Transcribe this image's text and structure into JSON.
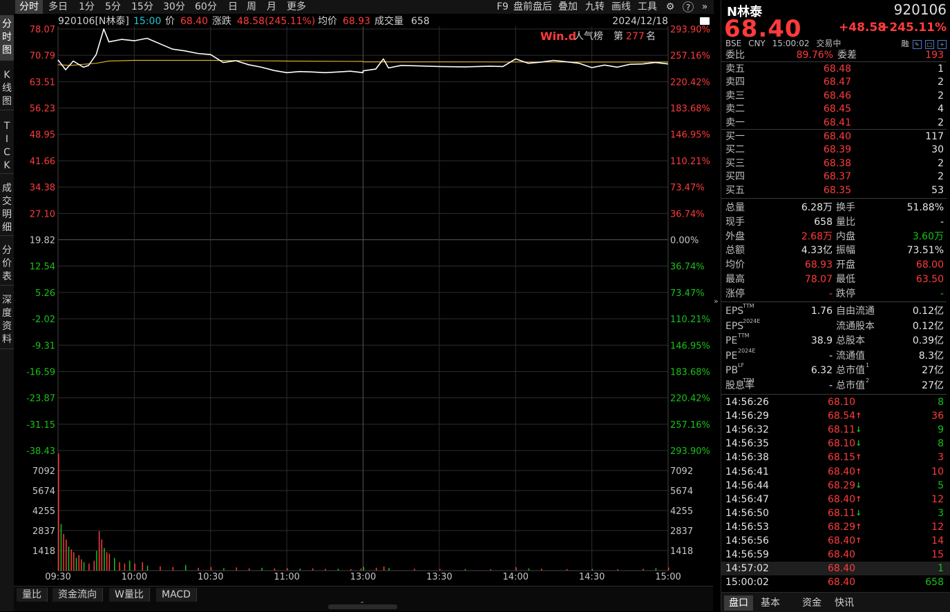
{
  "toolbar": {
    "periods": [
      "分时",
      "多日",
      "1分",
      "5分",
      "15分",
      "30分",
      "60分",
      "日",
      "周",
      "月",
      "更多"
    ],
    "active_period": "分时",
    "right_items": [
      "F9",
      "盘前盘后",
      "叠加",
      "九转",
      "画线",
      "工具"
    ],
    "settings_icon": "gear-icon",
    "help_icon": "help-icon",
    "expand_icon": "double-chevron-right-icon"
  },
  "sidebar": {
    "items": [
      "分时图",
      "K线图",
      "TICK",
      "成交明细",
      "分价表",
      "深度资料"
    ],
    "active": "分时图"
  },
  "chart_header": {
    "code_name": "920106[N林泰]",
    "time": "15:00",
    "price_label": "价",
    "price": "68.40",
    "change_label": "涨跌",
    "change": "48.58(245.11%)",
    "avg_label": "均价",
    "avg": "68.93",
    "volume_label": "成交量",
    "volume": "658",
    "date": "2024/12/18",
    "wind_brand": "Win.d",
    "popularity_label": "人气榜",
    "rank_prefix": "第",
    "rank": "277",
    "rank_suffix": "名"
  },
  "chart_data": {
    "type": "line",
    "title": "",
    "prev_close": 19.82,
    "price_ticks_upper": [
      "78.07",
      "70.79",
      "63.51",
      "56.23",
      "48.95",
      "41.66",
      "34.38",
      "27.10"
    ],
    "price_tick_center": "19.82",
    "price_ticks_lower": [
      "12.54",
      "5.26",
      "-2.02",
      "-9.31",
      "-16.59",
      "-23.87",
      "-31.15",
      "-38.43"
    ],
    "pct_ticks_upper": [
      "293.90%",
      "257.16%",
      "220.42%",
      "183.68%",
      "146.95%",
      "110.21%",
      "73.47%",
      "36.74%"
    ],
    "pct_tick_center": "0.00%",
    "pct_ticks_lower": [
      "36.74%",
      "73.47%",
      "110.21%",
      "146.95%",
      "183.68%",
      "220.42%",
      "257.16%",
      "293.90%"
    ],
    "volume_ticks": [
      "7092",
      "5674",
      "4255",
      "2837",
      "1418"
    ],
    "time_ticks": [
      "09:30",
      "10:00",
      "10:30",
      "11:00",
      "13:00",
      "13:30",
      "14:00",
      "14:30",
      "15:00"
    ],
    "ylim": [
      -38.43,
      78.07
    ],
    "volume_max": 8510,
    "series": [
      {
        "name": "价",
        "color": "#ffffff",
        "times": [
          "09:30",
          "09:33",
          "09:36",
          "09:40",
          "09:42",
          "09:45",
          "09:48",
          "09:50",
          "09:55",
          "10:00",
          "10:05",
          "10:10",
          "10:15",
          "10:20",
          "10:25",
          "10:30",
          "10:35",
          "10:40",
          "10:45",
          "10:50",
          "10:55",
          "11:00",
          "11:05",
          "11:10",
          "11:15",
          "11:20",
          "11:25",
          "11:30",
          "13:00",
          "13:05",
          "13:08",
          "13:10",
          "13:15",
          "13:20",
          "13:30",
          "13:40",
          "13:50",
          "13:55",
          "14:00",
          "14:05",
          "14:10",
          "14:15",
          "14:20",
          "14:25",
          "14:30",
          "14:35",
          "14:40",
          "14:45",
          "14:50",
          "14:55",
          "15:00"
        ],
        "values": [
          69.5,
          66.8,
          69.2,
          67.5,
          68.0,
          71.0,
          78.07,
          74.5,
          75.2,
          74.8,
          75.5,
          74.0,
          72.5,
          72.0,
          71.3,
          71.0,
          68.8,
          69.3,
          68.2,
          67.5,
          66.6,
          66.0,
          66.3,
          66.2,
          66.0,
          66.2,
          66.4,
          66.0,
          66.5,
          67.0,
          69.8,
          67.3,
          68.0,
          67.9,
          67.7,
          67.6,
          67.8,
          67.7,
          69.8,
          68.6,
          68.9,
          69.4,
          69.0,
          68.6,
          67.4,
          68.1,
          67.5,
          68.3,
          68.4,
          68.8,
          68.4
        ]
      },
      {
        "name": "均价",
        "color": "#d9b030",
        "times": [
          "09:30",
          "09:35",
          "09:40",
          "09:45",
          "09:50",
          "10:00",
          "10:30",
          "11:00",
          "11:30",
          "13:00",
          "13:30",
          "14:00",
          "14:30",
          "15:00"
        ],
        "values": [
          68.2,
          68.0,
          68.3,
          68.6,
          69.2,
          69.4,
          69.4,
          69.2,
          69.1,
          69.0,
          69.0,
          68.95,
          68.93,
          68.93
        ]
      }
    ],
    "volume_bars": [
      {
        "time": "09:30",
        "value": 8300
      },
      {
        "time": "09:31",
        "value": 3300
      },
      {
        "time": "09:32",
        "value": 2600
      },
      {
        "time": "09:33",
        "value": 2200
      },
      {
        "time": "09:34",
        "value": 1700
      },
      {
        "time": "09:35",
        "value": 1500
      },
      {
        "time": "09:36",
        "value": 1300
      },
      {
        "time": "09:37",
        "value": 900
      },
      {
        "time": "09:38",
        "value": 1100
      },
      {
        "time": "09:39",
        "value": 800
      },
      {
        "time": "09:40",
        "value": 600
      },
      {
        "time": "09:42",
        "value": 500
      },
      {
        "time": "09:44",
        "value": 700
      },
      {
        "time": "09:45",
        "value": 1400
      },
      {
        "time": "09:46",
        "value": 2800
      },
      {
        "time": "09:47",
        "value": 2200
      },
      {
        "time": "09:48",
        "value": 1600
      },
      {
        "time": "09:49",
        "value": 1300
      },
      {
        "time": "09:50",
        "value": 1200
      },
      {
        "time": "09:52",
        "value": 900
      },
      {
        "time": "09:54",
        "value": 600
      },
      {
        "time": "09:56",
        "value": 500
      },
      {
        "time": "09:58",
        "value": 700
      },
      {
        "time": "10:00",
        "value": 500
      },
      {
        "time": "10:03",
        "value": 600
      },
      {
        "time": "10:05",
        "value": 350
      },
      {
        "time": "10:10",
        "value": 300
      },
      {
        "time": "10:15",
        "value": 250
      },
      {
        "time": "10:20",
        "value": 400
      },
      {
        "time": "10:25",
        "value": 200
      },
      {
        "time": "10:30",
        "value": 250
      },
      {
        "time": "10:35",
        "value": 180
      },
      {
        "time": "10:40",
        "value": 220
      },
      {
        "time": "10:45",
        "value": 160
      },
      {
        "time": "10:50",
        "value": 200
      },
      {
        "time": "10:55",
        "value": 150
      },
      {
        "time": "11:00",
        "value": 180
      },
      {
        "time": "11:05",
        "value": 140
      },
      {
        "time": "11:10",
        "value": 160
      },
      {
        "time": "11:15",
        "value": 120
      },
      {
        "time": "11:20",
        "value": 130
      },
      {
        "time": "11:25",
        "value": 110
      },
      {
        "time": "11:29",
        "value": 150
      },
      {
        "time": "13:00",
        "value": 260
      },
      {
        "time": "13:05",
        "value": 200
      },
      {
        "time": "13:08",
        "value": 300
      },
      {
        "time": "13:10",
        "value": 180
      },
      {
        "time": "13:20",
        "value": 130
      },
      {
        "time": "13:30",
        "value": 120
      },
      {
        "time": "13:40",
        "value": 110
      },
      {
        "time": "13:50",
        "value": 100
      },
      {
        "time": "14:00",
        "value": 240
      },
      {
        "time": "14:05",
        "value": 160
      },
      {
        "time": "14:10",
        "value": 130
      },
      {
        "time": "14:20",
        "value": 110
      },
      {
        "time": "14:30",
        "value": 120
      },
      {
        "time": "14:40",
        "value": 100
      },
      {
        "time": "14:50",
        "value": 130
      },
      {
        "time": "14:55",
        "value": 180
      },
      {
        "time": "15:00",
        "value": 220
      }
    ]
  },
  "chart_tabs": [
    "量比",
    "资金流向",
    "W量比",
    "MACD"
  ],
  "quote": {
    "name": "N林泰",
    "code": "920106",
    "price": "68.40",
    "change": "+48.58",
    "pct": "+245.11%",
    "exchange": "BSE",
    "currency": "CNY",
    "time": "15:00:02",
    "status": "交易中",
    "badge": "融",
    "weibi_label": "委比",
    "weibi": "89.76%",
    "weicha_label": "委差",
    "weicha": "193",
    "asks": [
      {
        "label": "卖五",
        "price": "68.48",
        "vol": "1"
      },
      {
        "label": "卖四",
        "price": "68.47",
        "vol": "2"
      },
      {
        "label": "卖三",
        "price": "68.46",
        "vol": "2"
      },
      {
        "label": "卖二",
        "price": "68.45",
        "vol": "4"
      },
      {
        "label": "卖一",
        "price": "68.41",
        "vol": "2"
      }
    ],
    "bids": [
      {
        "label": "买一",
        "price": "68.40",
        "vol": "117"
      },
      {
        "label": "买二",
        "price": "68.39",
        "vol": "30"
      },
      {
        "label": "买三",
        "price": "68.38",
        "vol": "2"
      },
      {
        "label": "买四",
        "price": "68.37",
        "vol": "2"
      },
      {
        "label": "买五",
        "price": "68.35",
        "vol": "53"
      }
    ],
    "stats": [
      {
        "l1": "总量",
        "v1": "6.28万",
        "c1": "white",
        "l2": "换手",
        "v2": "51.88%",
        "c2": "white"
      },
      {
        "l1": "现手",
        "v1": "658",
        "c1": "white",
        "l2": "量比",
        "v2": "-",
        "c2": "white"
      },
      {
        "l1": "外盘",
        "v1": "2.68万",
        "c1": "red",
        "l2": "内盘",
        "v2": "3.60万",
        "c2": "green"
      },
      {
        "l1": "总额",
        "v1": "4.33亿",
        "c1": "white",
        "l2": "振幅",
        "v2": "73.51%",
        "c2": "white"
      },
      {
        "l1": "均价",
        "v1": "68.93",
        "c1": "red",
        "l2": "开盘",
        "v2": "68.00",
        "c2": "red"
      },
      {
        "l1": "最高",
        "v1": "78.07",
        "c1": "red",
        "l2": "最低",
        "v2": "63.50",
        "c2": "red"
      },
      {
        "l1": "涨停",
        "v1": "-",
        "c1": "red",
        "l2": "跌停",
        "v2": "-",
        "c2": "green"
      }
    ],
    "fundamentals": [
      {
        "l1": "EPS",
        "s1": "TTM",
        "v1": "1.76",
        "l2": "自由流通",
        "s2": "",
        "v2": "0.12亿"
      },
      {
        "l1": "EPS",
        "s1": "2024E",
        "v1": "",
        "l2": "流通股本",
        "s2": "",
        "v2": "0.12亿"
      },
      {
        "l1": "PE",
        "s1": "TTM",
        "v1": "38.9",
        "l2": "总股本",
        "s2": "",
        "v2": "0.39亿"
      },
      {
        "l1": "PE",
        "s1": "2024E",
        "v1": "-",
        "l2": "流通值",
        "s2": "",
        "v2": "8.3亿"
      },
      {
        "l1": "PB",
        "s1": "LF",
        "v1": "6.32",
        "l2": "总市值",
        "s2": "1",
        "v2": "27亿"
      },
      {
        "l1": "股息率",
        "s1": "TTM",
        "v1": "-",
        "l2": "总市值",
        "s2": "2",
        "v2": "27亿"
      }
    ],
    "ticks": [
      {
        "time": "14:56:26",
        "price": "68.10",
        "dir": "",
        "vol": "8",
        "vcolor": "green"
      },
      {
        "time": "14:56:29",
        "price": "68.54",
        "dir": "↑",
        "vol": "36",
        "vcolor": "red"
      },
      {
        "time": "14:56:32",
        "price": "68.11",
        "dir": "↓",
        "vol": "9",
        "vcolor": "green"
      },
      {
        "time": "14:56:35",
        "price": "68.10",
        "dir": "↓",
        "vol": "8",
        "vcolor": "green"
      },
      {
        "time": "14:56:38",
        "price": "68.15",
        "dir": "↑",
        "vol": "3",
        "vcolor": "red"
      },
      {
        "time": "14:56:41",
        "price": "68.40",
        "dir": "↑",
        "vol": "10",
        "vcolor": "red"
      },
      {
        "time": "14:56:44",
        "price": "68.29",
        "dir": "↓",
        "vol": "5",
        "vcolor": "green"
      },
      {
        "time": "14:56:47",
        "price": "68.40",
        "dir": "↑",
        "vol": "12",
        "vcolor": "red"
      },
      {
        "time": "14:56:50",
        "price": "68.11",
        "dir": "↓",
        "vol": "3",
        "vcolor": "green"
      },
      {
        "time": "14:56:53",
        "price": "68.29",
        "dir": "↑",
        "vol": "12",
        "vcolor": "red"
      },
      {
        "time": "14:56:56",
        "price": "68.40",
        "dir": "↑",
        "vol": "14",
        "vcolor": "red"
      },
      {
        "time": "14:56:59",
        "price": "68.40",
        "dir": "",
        "vol": "15",
        "vcolor": "red"
      },
      {
        "time": "14:57:02",
        "price": "68.40",
        "dir": "",
        "vol": "1",
        "vcolor": "green"
      },
      {
        "time": "15:00:02",
        "price": "68.40",
        "dir": "",
        "vol": "658",
        "vcolor": "green"
      }
    ],
    "tabs": [
      "盘口",
      "基本",
      "资金",
      "快讯"
    ],
    "active_tab": "盘口"
  },
  "colors": {
    "up": "#ff3b3b",
    "down": "#19c219",
    "price_line": "#ffffff",
    "avg_line": "#d9b030",
    "grid": "#2e2e2e"
  }
}
